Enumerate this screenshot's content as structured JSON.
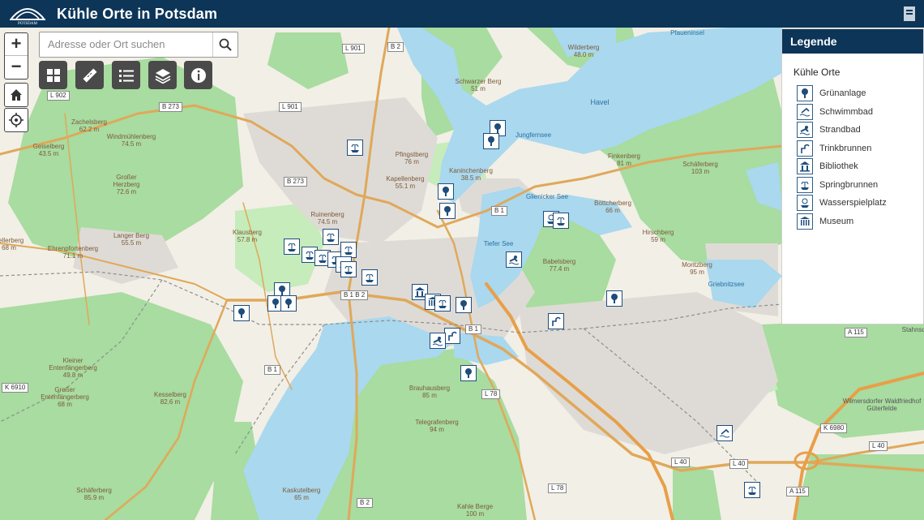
{
  "header": {
    "logo_text": "POTSDAM",
    "title": "Kühle Orte in Potsdam",
    "header_icon": "print-icon"
  },
  "search": {
    "placeholder": "Adresse oder Ort suchen",
    "value": ""
  },
  "zoom": {
    "in": "+",
    "out": "−"
  },
  "toolbar": [
    {
      "name": "basemap-gallery",
      "icon": "grid-icon"
    },
    {
      "name": "measure",
      "icon": "ruler-icon"
    },
    {
      "name": "layer-list",
      "icon": "list-icon"
    },
    {
      "name": "layers",
      "icon": "layers-icon"
    },
    {
      "name": "about",
      "icon": "info-icon"
    }
  ],
  "legend": {
    "title": "Legende",
    "subtitle": "Kühle Orte",
    "items": [
      {
        "label": "Grünanlage",
        "icon": "tree-icon"
      },
      {
        "label": "Schwimmbad",
        "icon": "swimming-pool-icon"
      },
      {
        "label": "Strandbad",
        "icon": "beach-swim-icon"
      },
      {
        "label": "Trinkbrunnen",
        "icon": "drinking-fountain-icon"
      },
      {
        "label": "Bibliothek",
        "icon": "library-icon"
      },
      {
        "label": "Springbrunnen",
        "icon": "fountain-icon"
      },
      {
        "label": "Wasserspielplatz",
        "icon": "water-playground-icon"
      },
      {
        "label": "Museum",
        "icon": "museum-icon"
      }
    ]
  },
  "map": {
    "places": [
      {
        "name": "Pfaueninsel",
        "height": ""
      },
      {
        "name": "Wilderberg",
        "height": "48.0 m"
      },
      {
        "name": "Schwarzer Berg",
        "height": "51 m"
      },
      {
        "name": "Havel",
        "height": ""
      },
      {
        "name": "Jungfernsee",
        "height": ""
      },
      {
        "name": "Pfingstberg",
        "height": "76 m"
      },
      {
        "name": "Kapellenberg",
        "height": "55.1 m"
      },
      {
        "name": "Kaninchenberg",
        "height": "38.5 m"
      },
      {
        "name": "Glienicker See",
        "height": ""
      },
      {
        "name": "Tiefer See",
        "height": ""
      },
      {
        "name": "Babelsberg",
        "height": "77.4 m"
      },
      {
        "name": "Ruinenberg",
        "height": "74.5 m"
      },
      {
        "name": "Klausberg",
        "height": "57.8 m"
      },
      {
        "name": "Zachelsberg",
        "height": "62.2 m"
      },
      {
        "name": "Windmühlenberg",
        "height": "74.5 m"
      },
      {
        "name": "Geiselberg",
        "height": "43.5 m"
      },
      {
        "name": "Großer Herzberg",
        "height": "72.6 m"
      },
      {
        "name": "Langer Berg",
        "height": "55.5 m"
      },
      {
        "name": "Ehrenpfortenberg",
        "height": "71.1 m"
      },
      {
        "name": "Kellerberg",
        "height": "68 m"
      },
      {
        "name": "Finkenberg",
        "height": "81 m"
      },
      {
        "name": "Schäferberg",
        "height": "103 m"
      },
      {
        "name": "Böttcherberg",
        "height": "66 m"
      },
      {
        "name": "Hirschberg",
        "height": "59 m"
      },
      {
        "name": "Moritzberg",
        "height": "95 m"
      },
      {
        "name": "Griebnitzsee",
        "height": ""
      },
      {
        "name": "Kleiner Entenfängerberg",
        "height": "49.8 m"
      },
      {
        "name": "Großer Entenfängerberg",
        "height": "68 m"
      },
      {
        "name": "Kesselberg",
        "height": "82.6 m"
      },
      {
        "name": "Brauhausberg",
        "height": "85 m"
      },
      {
        "name": "Telegrafenberg",
        "height": "94 m"
      },
      {
        "name": "Schäferberg",
        "height": "85.9 m"
      },
      {
        "name": "Kaskutelberg",
        "height": "65 m"
      },
      {
        "name": "Kahle Berge",
        "height": "100 m"
      },
      {
        "name": "Wilmersdorfer Waldfriedhof Güterfelde",
        "height": ""
      },
      {
        "name": "Stahnsdorf",
        "height": ""
      }
    ],
    "roads": [
      "L 901",
      "B 2",
      "L 902",
      "B 273",
      "L 901",
      "B 273",
      "B 1",
      "B 1",
      "B 1 B 2",
      "B 1",
      "L 78",
      "L 78",
      "B 2",
      "L 40",
      "L 40",
      "L 40",
      "K 6910",
      "K 6980",
      "A 115",
      "A 115"
    ]
  }
}
